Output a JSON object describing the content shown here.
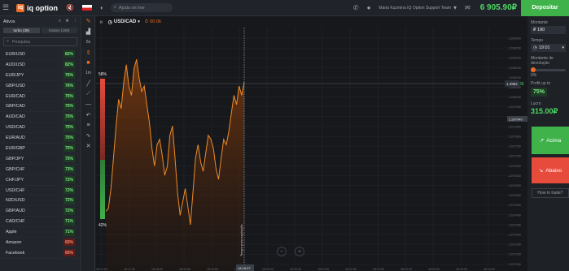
{
  "topbar": {
    "logo_text": "iq option",
    "logo_mark": "iq",
    "help_placeholder": "Ajuda on line",
    "user_name": "Maria Kuzmina IQ Option Support Team",
    "balance": "6 905.90₽",
    "deposit_label": "Depositar",
    "icons": [
      "menu-icon",
      "mute-icon",
      "flag-icon",
      "brightness-icon",
      "search-icon",
      "phone-icon",
      "user-icon",
      "chevron-down-icon",
      "mail-icon"
    ]
  },
  "assets_panel": {
    "title": "Ativos",
    "tabs": [
      {
        "label": "turbo (39)",
        "active": true
      },
      {
        "label": "binário (100)",
        "active": false
      }
    ],
    "search_placeholder": "Pesquisa",
    "items": [
      {
        "name": "EUR/USD",
        "payout": "82%",
        "tone": "g"
      },
      {
        "name": "AUD/USD",
        "payout": "82%",
        "tone": "g"
      },
      {
        "name": "EUR/JPY",
        "payout": "76%",
        "tone": "g"
      },
      {
        "name": "GBP/USD",
        "payout": "76%",
        "tone": "g"
      },
      {
        "name": "EUR/CAD",
        "payout": "75%",
        "tone": "g"
      },
      {
        "name": "GBP/CAD",
        "payout": "75%",
        "tone": "g"
      },
      {
        "name": "AUD/CAD",
        "payout": "75%",
        "tone": "g"
      },
      {
        "name": "USD/CAD",
        "payout": "75%",
        "tone": "g"
      },
      {
        "name": "EUR/AUD",
        "payout": "75%",
        "tone": "g"
      },
      {
        "name": "EUR/GBP",
        "payout": "75%",
        "tone": "g"
      },
      {
        "name": "GBP/JPY",
        "payout": "75%",
        "tone": "g"
      },
      {
        "name": "GBP/CHF",
        "payout": "73%",
        "tone": "g"
      },
      {
        "name": "CHF/JPY",
        "payout": "72%",
        "tone": "g"
      },
      {
        "name": "USD/CHF",
        "payout": "72%",
        "tone": "g"
      },
      {
        "name": "NZD/USD",
        "payout": "72%",
        "tone": "g"
      },
      {
        "name": "GBP/AUD",
        "payout": "72%",
        "tone": "g"
      },
      {
        "name": "CAD/CHF",
        "payout": "71%",
        "tone": "g"
      },
      {
        "name": "Apple",
        "payout": "71%",
        "tone": "g"
      },
      {
        "name": "Amazon",
        "payout": "65%",
        "tone": "r"
      },
      {
        "name": "Facebook",
        "payout": "65%",
        "tone": "r"
      }
    ]
  },
  "tools": [
    "pencil-icon",
    "chart-type-icon",
    "timeframe-label",
    "indicator-icon",
    "square-icon",
    "timeframe-1m",
    "line-tool-icon",
    "ray-icon",
    "horizontal-line-icon",
    "undo-icon",
    "fib-icon",
    "wave-icon",
    "delete-icon"
  ],
  "tools_labels": {
    "tf_a": "5s",
    "tf_b": "1m"
  },
  "chart": {
    "close_symbol": "×",
    "pair": "USD/CAD",
    "timer": "00:06",
    "sentiment_top": "58%",
    "sentiment_bottom": "42%",
    "expiry_label": "Tempo para expiração",
    "current_price": "1.2982",
    "price_tag_mini": "1.297940",
    "y_ticks": [
      "1.298300",
      "1.298250",
      "1.298200",
      "1.298150",
      "1.298100",
      "1.298050",
      "1.298000",
      "1.297950",
      "1.297900",
      "1.297850",
      "1.297800",
      "1.297750",
      "1.297700",
      "1.297650",
      "1.297600",
      "1.297550",
      "1.297500",
      "1.297450",
      "1.297400",
      "1.297350",
      "1.297300",
      "1.297250",
      "1.297200",
      "1.297150"
    ],
    "x_ticks": [
      "18:17:00",
      "18:17:30",
      "18:18:00",
      "18:18:30",
      "18:19:00",
      "18:19:30",
      "18:20:00",
      "18:20:30",
      "18:21:00",
      "18:21:30",
      "18:22:00",
      "18:22:30",
      "18:23:00",
      "18:23:30",
      "18:24:00"
    ],
    "current_x_label": "18:18:37",
    "colors": {
      "line": "#f08a24",
      "area": "#5a2a0c",
      "up": "#3fb24a",
      "down": "#e64b3b"
    },
    "timer_value": "30"
  },
  "chart_data": {
    "type": "area",
    "series": [
      {
        "values": [
          1.29728,
          1.2973,
          1.29745,
          1.29768,
          1.29792,
          1.29812,
          1.29805,
          1.29825,
          1.29838,
          1.29822,
          1.29815,
          1.29835,
          1.29842,
          1.29828,
          1.29818,
          1.29822,
          1.29808,
          1.29795,
          1.29775,
          1.29762,
          1.29778,
          1.29782,
          1.2977,
          1.29755,
          1.29762,
          1.29785,
          1.29792,
          1.29768,
          1.29742,
          1.29725,
          1.29735,
          1.29745,
          1.29732,
          1.29718,
          1.29742,
          1.29768,
          1.29778,
          1.29765,
          1.29758,
          1.29772,
          1.29785,
          1.29782,
          1.29775,
          1.2976,
          1.29752,
          1.29768,
          1.29782,
          1.29778,
          1.29788,
          1.29802,
          1.29815,
          1.29808,
          1.29822,
          1.29815,
          1.29825
        ]
      }
    ],
    "ylim": [
      1.2971,
      1.2985
    ]
  },
  "trade_panel": {
    "amount_label": "Montante",
    "amount_value": "₽ 180",
    "time_label": "Tempo",
    "time_value": "19:01",
    "refund_label": "Montante de devolução",
    "refund_value": "0%",
    "refund_fraction": 0.0,
    "profit_label": "Profit up to",
    "profit_value": "75%",
    "lucro_label": "Lucro",
    "lucro_value": "315.00₽",
    "up_label": "Acima",
    "down_label": "Abaixo",
    "howto_label": "How to trade?"
  }
}
